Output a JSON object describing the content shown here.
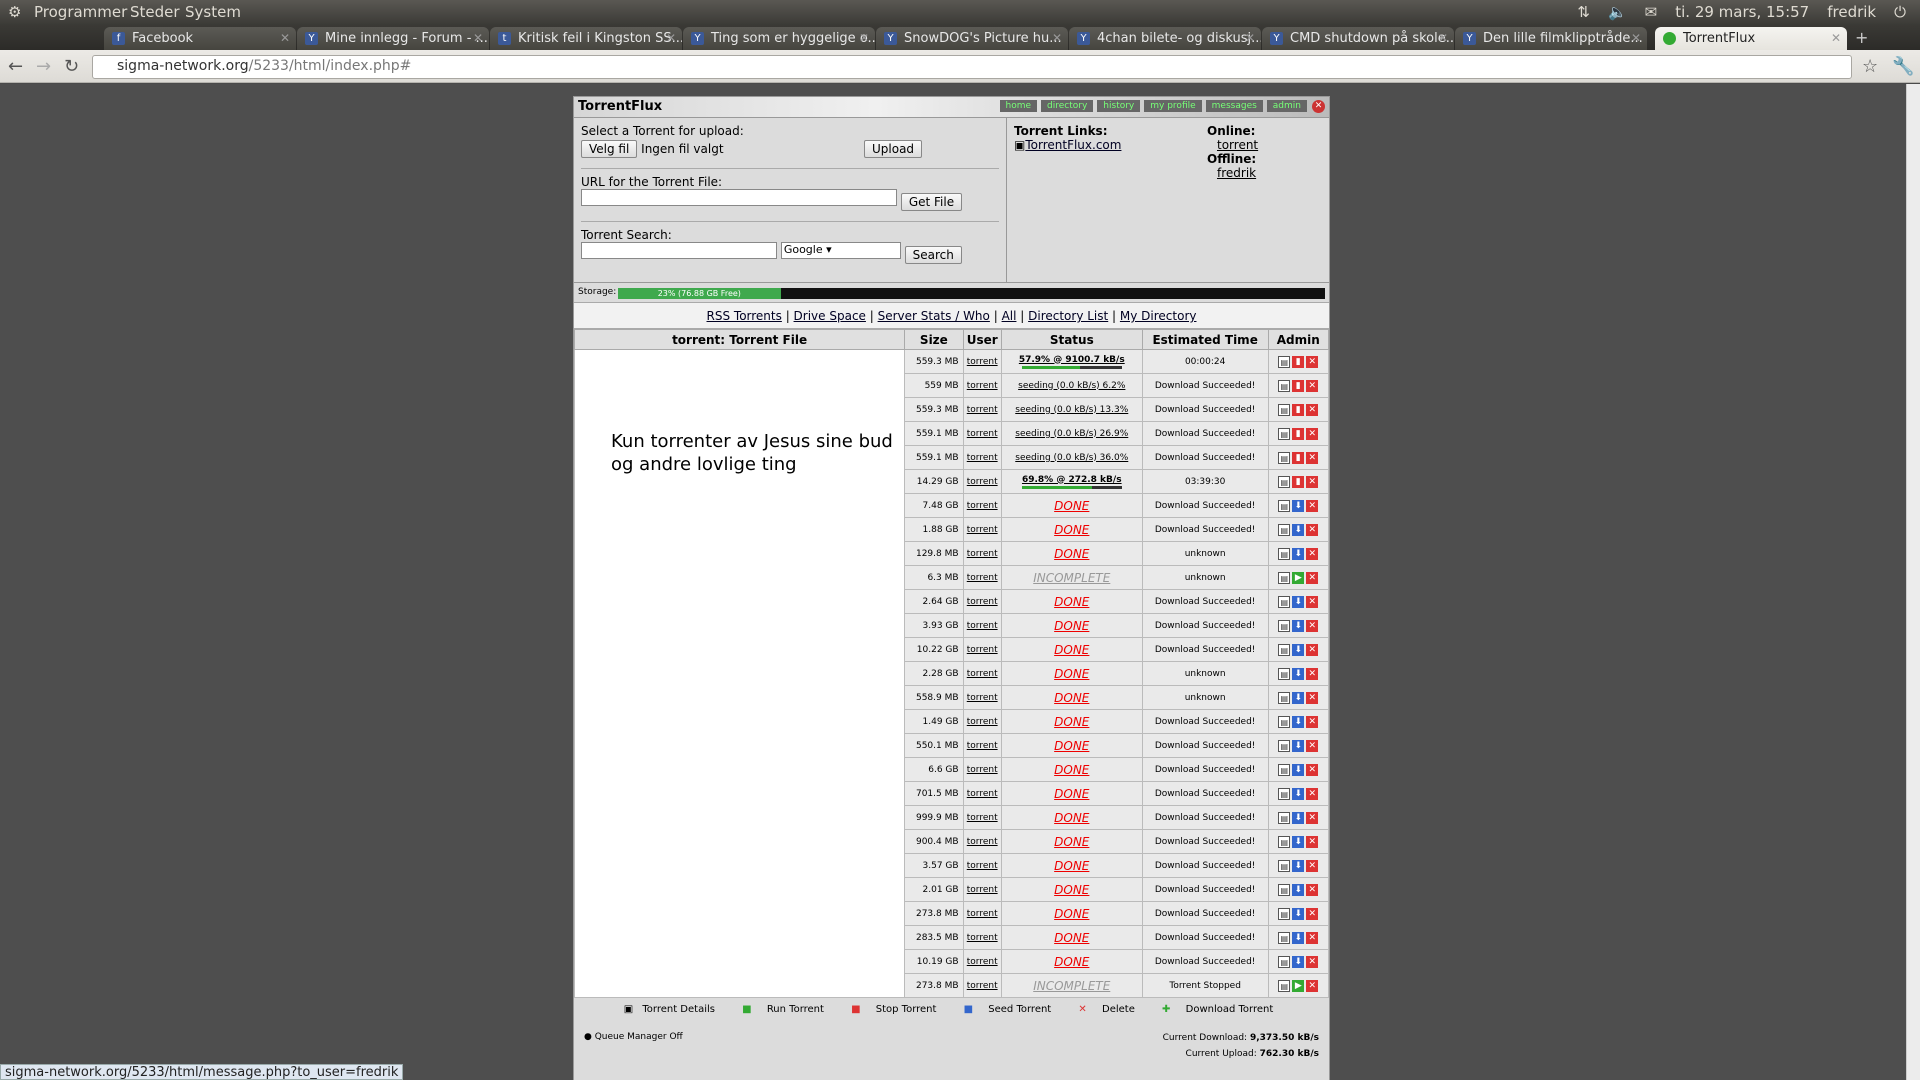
{
  "panel": {
    "menus": [
      "Programmer",
      "Steder",
      "System"
    ],
    "clock": "ti. 29 mars, 15:57",
    "user": "fredrik"
  },
  "tabs": [
    "Facebook",
    "Mine innlegg - Forum - ...",
    "Kritisk feil i Kingston SS...",
    "Ting som er hyggelige o...",
    "SnowDOG's Picture hu...",
    "4chan bilete- og diskusj...",
    "CMD shutdown på skole...",
    "Den lille filmklipptråde...",
    "TorrentFlux"
  ],
  "url": {
    "host": "sigma-network.org",
    "path": "/5233/html/index.php#"
  },
  "tf": {
    "title": "TorrentFlux",
    "nav": [
      "home",
      "directory",
      "history",
      "my profile",
      "messages",
      "admin"
    ],
    "upload_label": "Select a Torrent for upload:",
    "choose_btn": "Velg fil",
    "no_file": "Ingen fil valgt",
    "upload_btn": "Upload",
    "url_label": "URL for the Torrent File:",
    "getfile_btn": "Get File",
    "search_label": "Torrent Search:",
    "engine": "Google",
    "search_btn": "Search",
    "links_label": "Torrent Links:",
    "link1": "TorrentFlux.com",
    "online_label": "Online:",
    "online_user": "torrent",
    "offline_label": "Offline:",
    "offline_user": "fredrik",
    "storage_label": "Storage:",
    "storage_text": "23% (76.88 GB Free)",
    "storage_pct": 23,
    "links": [
      "RSS Torrents",
      "Drive Space",
      "Server Stats / Who",
      "All",
      "Directory List",
      "My Directory"
    ],
    "headers": [
      "torrent: Torrent File",
      "Size",
      "User",
      "Status",
      "Estimated Time",
      "Admin"
    ],
    "desc": "Kun torrenter av Jesus sine bud og andre lovlige ting",
    "legend": [
      "Torrent Details",
      "Run Torrent",
      "Stop Torrent",
      "Seed Torrent",
      "Delete",
      "Download Torrent"
    ],
    "queue": "Queue Manager Off",
    "cur_dl_label": "Current Download:",
    "cur_dl": "9,373.50 kB/s",
    "cur_ul_label": "Current Upload:",
    "cur_ul": "762.30 kB/s"
  },
  "rows": [
    {
      "size": "559.3 MB",
      "user": "torrent",
      "status": "57.9% @ 9100.7 kB/s",
      "kind": "prog",
      "pct": 57.9,
      "est": "00:00:24"
    },
    {
      "size": "559 MB",
      "user": "torrent",
      "status": "seeding (0.0 kB/s) 6.2%",
      "kind": "seed",
      "est": "Download Succeeded!"
    },
    {
      "size": "559.3 MB",
      "user": "torrent",
      "status": "seeding (0.0 kB/s) 13.3%",
      "kind": "seed",
      "est": "Download Succeeded!"
    },
    {
      "size": "559.1 MB",
      "user": "torrent",
      "status": "seeding (0.0 kB/s) 26.9%",
      "kind": "seed",
      "est": "Download Succeeded!"
    },
    {
      "size": "559.1 MB",
      "user": "torrent",
      "status": "seeding (0.0 kB/s) 36.0%",
      "kind": "seed",
      "est": "Download Succeeded!"
    },
    {
      "size": "14.29 GB",
      "user": "torrent",
      "status": "69.8% @ 272.8 kB/s",
      "kind": "prog",
      "pct": 69.8,
      "est": "03:39:30"
    },
    {
      "size": "7.48 GB",
      "user": "torrent",
      "status": "DONE",
      "kind": "done",
      "est": "Download Succeeded!"
    },
    {
      "size": "1.88 GB",
      "user": "torrent",
      "status": "DONE",
      "kind": "done",
      "est": "Download Succeeded!"
    },
    {
      "size": "129.8 MB",
      "user": "torrent",
      "status": "DONE",
      "kind": "done",
      "est": "unknown"
    },
    {
      "size": "6.3 MB",
      "user": "torrent",
      "status": "INCOMPLETE",
      "kind": "inc",
      "est": "unknown"
    },
    {
      "size": "2.64 GB",
      "user": "torrent",
      "status": "DONE",
      "kind": "done",
      "est": "Download Succeeded!"
    },
    {
      "size": "3.93 GB",
      "user": "torrent",
      "status": "DONE",
      "kind": "done",
      "est": "Download Succeeded!"
    },
    {
      "size": "10.22 GB",
      "user": "torrent",
      "status": "DONE",
      "kind": "done",
      "est": "Download Succeeded!"
    },
    {
      "size": "2.28 GB",
      "user": "torrent",
      "status": "DONE",
      "kind": "done",
      "est": "unknown"
    },
    {
      "size": "558.9 MB",
      "user": "torrent",
      "status": "DONE",
      "kind": "done",
      "est": "unknown"
    },
    {
      "size": "1.49 GB",
      "user": "torrent",
      "status": "DONE",
      "kind": "done",
      "est": "Download Succeeded!"
    },
    {
      "size": "550.1 MB",
      "user": "torrent",
      "status": "DONE",
      "kind": "done",
      "est": "Download Succeeded!"
    },
    {
      "size": "6.6 GB",
      "user": "torrent",
      "status": "DONE",
      "kind": "done",
      "est": "Download Succeeded!"
    },
    {
      "size": "701.5 MB",
      "user": "torrent",
      "status": "DONE",
      "kind": "done",
      "est": "Download Succeeded!"
    },
    {
      "size": "999.9 MB",
      "user": "torrent",
      "status": "DONE",
      "kind": "done",
      "est": "Download Succeeded!"
    },
    {
      "size": "900.4 MB",
      "user": "torrent",
      "status": "DONE",
      "kind": "done",
      "est": "Download Succeeded!"
    },
    {
      "size": "3.57 GB",
      "user": "torrent",
      "status": "DONE",
      "kind": "done",
      "est": "Download Succeeded!"
    },
    {
      "size": "2.01 GB",
      "user": "torrent",
      "status": "DONE",
      "kind": "done",
      "est": "Download Succeeded!"
    },
    {
      "size": "273.8 MB",
      "user": "torrent",
      "status": "DONE",
      "kind": "done",
      "est": "Download Succeeded!"
    },
    {
      "size": "283.5 MB",
      "user": "torrent",
      "status": "DONE",
      "kind": "done",
      "est": "Download Succeeded!"
    },
    {
      "size": "10.19 GB",
      "user": "torrent",
      "status": "DONE",
      "kind": "done",
      "est": "Download Succeeded!"
    },
    {
      "size": "273.8 MB",
      "user": "torrent",
      "status": "INCOMPLETE",
      "kind": "inc",
      "est": "Torrent Stopped"
    }
  ],
  "statusbar": "sigma-network.org/5233/html/message.php?to_user=fredrik"
}
